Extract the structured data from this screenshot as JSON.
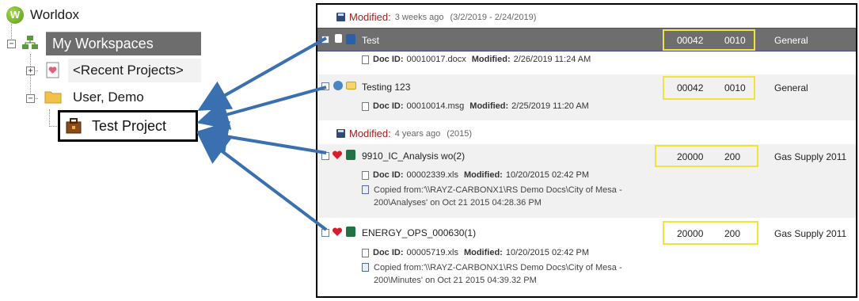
{
  "tree": {
    "app_title": "Worldox",
    "logo_letter": "W",
    "workspace": "My Workspaces",
    "recent": "<Recent Projects>",
    "user": "User, Demo",
    "project": "Test Project"
  },
  "groups": [
    {
      "label": "Modified:",
      "when": "3 weeks ago",
      "range": "(3/2/2019 - 2/24/2019)"
    },
    {
      "label": "Modified:",
      "when": "4 years ago",
      "range": "(2015)"
    }
  ],
  "docs": [
    {
      "title": "Test",
      "num1": "00042",
      "num2": "0010",
      "category": "General",
      "doc_id_label": "Doc ID:",
      "doc_id": "00010017.docx",
      "modified_label": "Modified:",
      "modified": "2/26/2019 11:24 AM",
      "copied": ""
    },
    {
      "title": "Testing 123",
      "num1": "00042",
      "num2": "0010",
      "category": "General",
      "doc_id_label": "Doc ID:",
      "doc_id": "00010014.msg",
      "modified_label": "Modified:",
      "modified": "2/25/2019 11:20 AM",
      "copied": ""
    },
    {
      "title": "9910_IC_Analysis wo(2)",
      "num1": "20000",
      "num2": "200",
      "category": "Gas Supply 2011",
      "doc_id_label": "Doc ID:",
      "doc_id": "00002339.xls",
      "modified_label": "Modified:",
      "modified": "10/20/2015 02:42 PM",
      "copied_1": "Copied from:'\\\\RAYZ-CARBONX1\\RS Demo Docs\\City of Mesa -",
      "copied_2": "200\\Analyses' on Oct 21 2015 04:28.36 PM"
    },
    {
      "title": "ENERGY_OPS_000630(1)",
      "num1": "20000",
      "num2": "200",
      "category": "Gas Supply 2011",
      "doc_id_label": "Doc ID:",
      "doc_id": "00005719.xls",
      "modified_label": "Modified:",
      "modified": "10/20/2015 02:42 PM",
      "copied_1": "Copied from:'\\\\RAYZ-CARBONX1\\RS Demo Docs\\City of Mesa -",
      "copied_2": "200\\Minutes' on Oct 21 2015 04:39.32 PM"
    }
  ],
  "colors": {
    "accent_arrow": "#3a6fb0",
    "highlight_box": "#f0e43a",
    "modified_red": "#a11d1d",
    "selected_row": "#6d6d6d"
  }
}
